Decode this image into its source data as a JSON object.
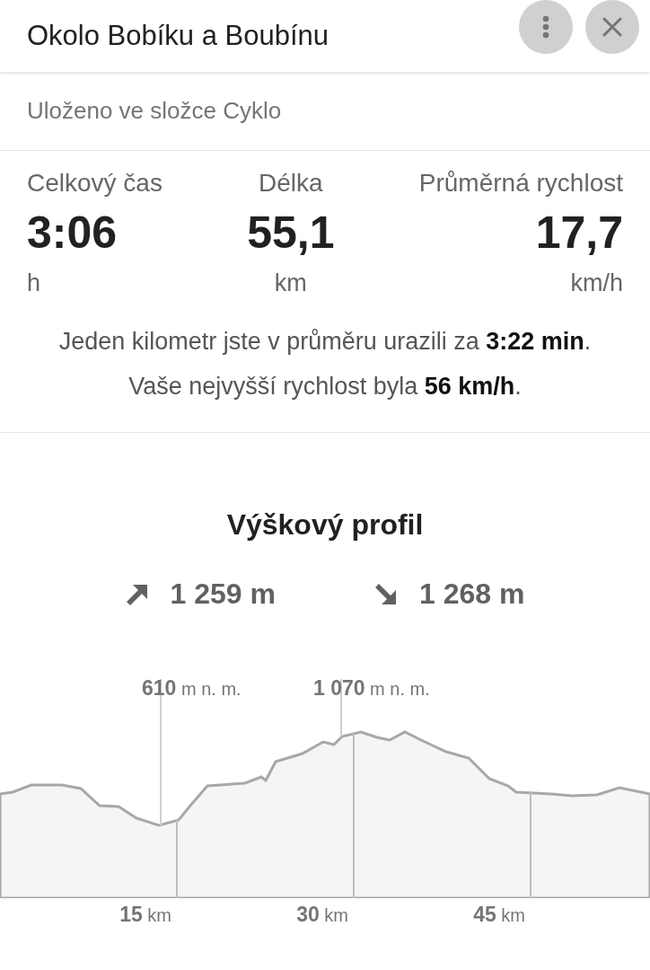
{
  "header": {
    "title": "Okolo Bobíku a Boubínu"
  },
  "folder": "Uloženo ve složce Cyklo",
  "stats": [
    {
      "label": "Celkový čas",
      "value": "3:06",
      "unit": "h"
    },
    {
      "label": "Délka",
      "value": "55,1",
      "unit": "km"
    },
    {
      "label": "Průměrná rychlost",
      "value": "17,7",
      "unit": "km/h"
    }
  ],
  "summary": [
    "Jeden kilometr jste v průměru urazili za **3:22 min**.",
    "Vaše nejvyšší rychlost byla **56 km/h**."
  ],
  "elevation": {
    "title": "Výškový profil",
    "ascent": "1 259 m",
    "descent": "1 268 m",
    "markers": [
      {
        "value": "610",
        "unit": "m n. m."
      },
      {
        "value": "1 070",
        "unit": "m n. m."
      }
    ],
    "distance_ticks": [
      {
        "value": "15",
        "unit": "km"
      },
      {
        "value": "30",
        "unit": "km"
      },
      {
        "value": "45",
        "unit": "km"
      }
    ]
  }
}
